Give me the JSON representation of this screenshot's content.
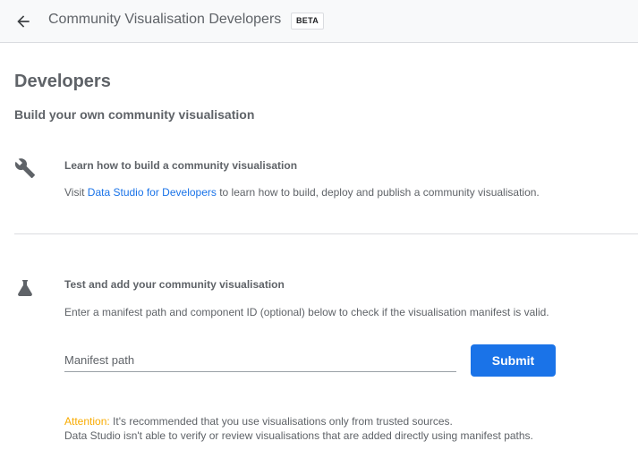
{
  "header": {
    "back_icon": "arrow-left-icon",
    "title": "Community Visualisation Developers",
    "badge": "BETA"
  },
  "page": {
    "title": "Developers",
    "subtitle": "Build your own community visualisation"
  },
  "learn_section": {
    "icon": "wrench-icon",
    "heading": "Learn how to build a community visualisation",
    "text_before": "Visit ",
    "link_text": "Data Studio for Developers",
    "text_after": " to learn how to build, deploy and publish a community visualisation."
  },
  "test_section": {
    "icon": "flask-icon",
    "heading": "Test and add your community visualisation",
    "description": "Enter a manifest path and component ID (optional) below to check if the visualisation manifest is valid.",
    "input_placeholder": "Manifest path",
    "input_value": "",
    "submit_label": "Submit"
  },
  "attention": {
    "label": "Attention:",
    "line1": " It's recommended that you use visualisations only from trusted sources.",
    "line2": "Data Studio isn't able to verify or review visualisations that are added directly using manifest paths."
  },
  "colors": {
    "accent": "#1a73e8",
    "warning": "#f9ab00",
    "text": "#5f6368"
  }
}
